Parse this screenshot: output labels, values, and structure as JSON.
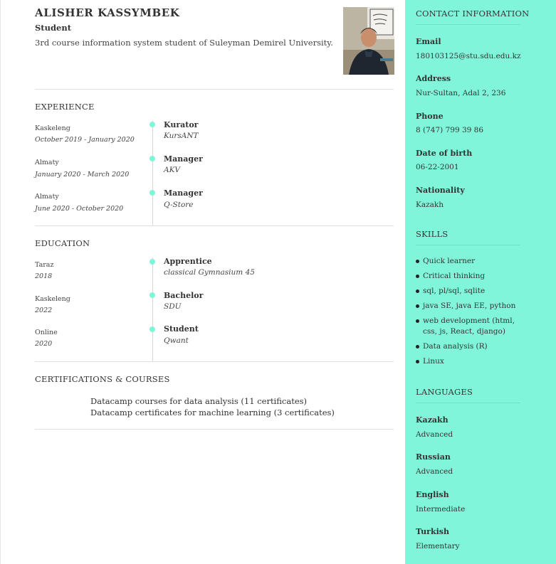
{
  "header": {
    "name": "ALISHER KASSYMBEK",
    "role": "Student",
    "summary": "3rd course information system student of Suleyman Demirel University."
  },
  "experience": {
    "title": "EXPERIENCE",
    "items": [
      {
        "location": "Kaskeleng",
        "dates": "October 2019 - January 2020",
        "position": "Kurator",
        "company": "KursANT"
      },
      {
        "location": "Almaty",
        "dates": "January 2020 - March 2020",
        "position": "Manager",
        "company": "AKV"
      },
      {
        "location": "Almaty",
        "dates": "June 2020 - October 2020",
        "position": "Manager",
        "company": "Q-Store"
      }
    ]
  },
  "education": {
    "title": "EDUCATION",
    "items": [
      {
        "location": "Taraz",
        "dates": "2018",
        "degree": "Apprentice",
        "school": "classical Gymnasium 45"
      },
      {
        "location": "Kaskeleng",
        "dates": "2022",
        "degree": "Bachelor",
        "school": "SDU"
      },
      {
        "location": "Online",
        "dates": "2020",
        "degree": "Student",
        "school": "Qwant"
      }
    ]
  },
  "certifications": {
    "title": "CERTIFICATIONS & COURSES",
    "items": [
      "Datacamp courses for data analysis (11 certificates)",
      "Datacamp certificates for machine learning (3 certificates)"
    ]
  },
  "contact": {
    "title": "CONTACT INFORMATION",
    "email_label": "Email",
    "email": "180103125@stu.sdu.edu.kz",
    "address_label": "Address",
    "address": "Nur-Sultan, Adal 2, 236",
    "phone_label": "Phone",
    "phone": "8 (747) 799 39 86",
    "dob_label": "Date of birth",
    "dob": "06-22-2001",
    "nationality_label": "Nationality",
    "nationality": "Kazakh"
  },
  "skills": {
    "title": "SKILLS",
    "items": [
      "Quick learner",
      "Critical thinking",
      "sql, pl/sql, sqlite",
      "java SE, java EE, python",
      "web development (html, css, js, React, django)",
      "Data analysis (R)",
      "Linux"
    ]
  },
  "languages": {
    "title": "LANGUAGES",
    "items": [
      {
        "name": "Kazakh",
        "level": "Advanced"
      },
      {
        "name": "Russian",
        "level": "Advanced"
      },
      {
        "name": "English",
        "level": "Intermediate"
      },
      {
        "name": "Turkish",
        "level": "Elementary"
      }
    ]
  },
  "colors": {
    "sidebar": "#80f5d9",
    "accent_dot": "#80f5d9"
  },
  "photo": {
    "icon": "profile-photo"
  }
}
